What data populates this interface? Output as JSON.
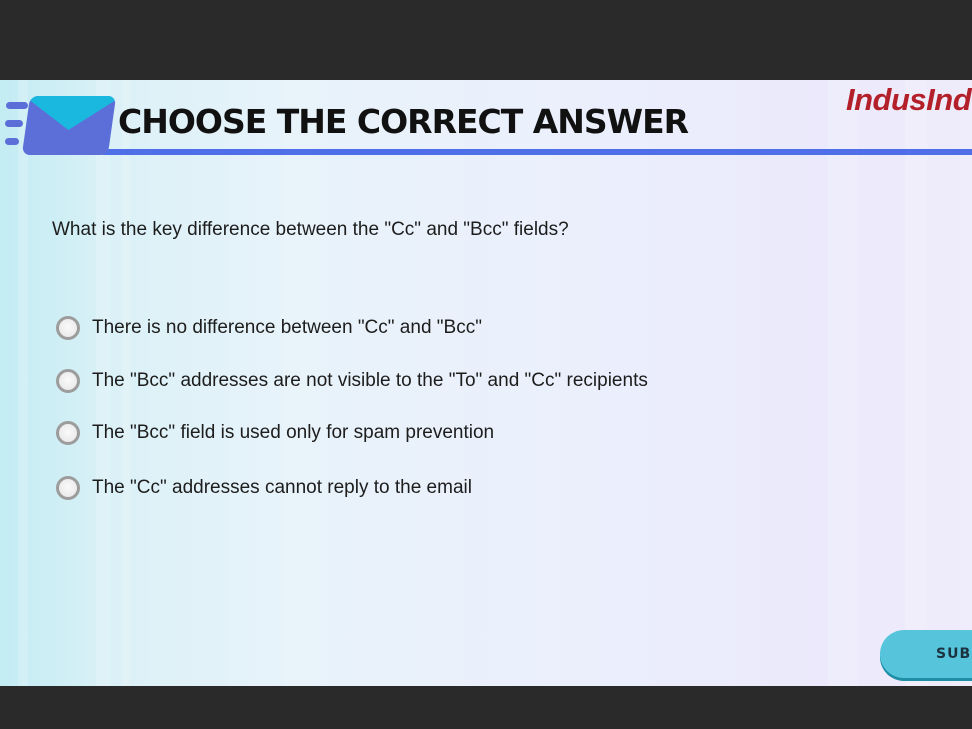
{
  "brand": {
    "logo_text": "IndusInd"
  },
  "header": {
    "title": "CHOOSE THE CORRECT ANSWER"
  },
  "quiz": {
    "question": "What is the key difference between the \"Cc\" and \"Bcc\" fields?",
    "options": [
      {
        "label": "There is no difference between \"Cc\" and \"Bcc\"",
        "selected": false
      },
      {
        "label": "The \"Bcc\" addresses are not visible to the \"To\" and \"Cc\" recipients",
        "selected": false
      },
      {
        "label": "The \"Bcc\" field is used only for spam prevention",
        "selected": false
      },
      {
        "label": "The \"Cc\" addresses cannot reply to the email",
        "selected": false
      }
    ],
    "submit_label": "SUBMIT"
  },
  "colors": {
    "accent_blue": "#4f6fe8",
    "envelope_blue": "#5c6fd8",
    "envelope_flap": "#1ab8de",
    "logo_red": "#b3202a",
    "submit_bg": "#56c5db"
  }
}
